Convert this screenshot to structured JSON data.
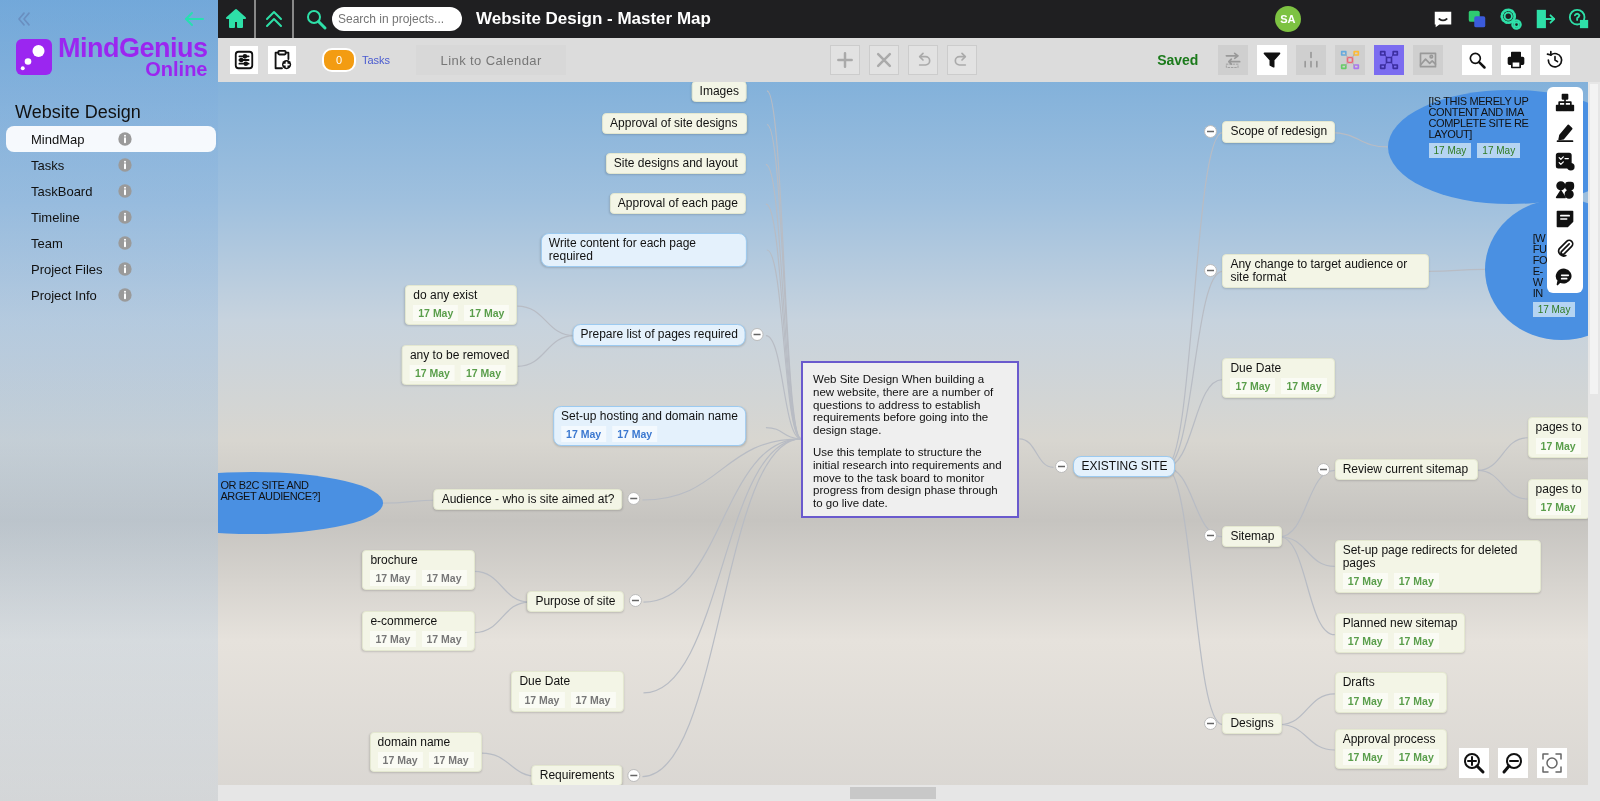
{
  "sidebar": {
    "logo": {
      "name": "MindGenius",
      "subtitle": "Online"
    },
    "project_title": "Website Design",
    "items": [
      {
        "label": "MindMap",
        "selected": true
      },
      {
        "label": "Tasks",
        "selected": false
      },
      {
        "label": "TaskBoard",
        "selected": false
      },
      {
        "label": "Timeline",
        "selected": false
      },
      {
        "label": "Team",
        "selected": false
      },
      {
        "label": "Project Files",
        "selected": false
      },
      {
        "label": "Project Info",
        "selected": false
      }
    ]
  },
  "topbar": {
    "search": {
      "placeholder": "Search in projects..."
    },
    "title": "Website Design - Master Map",
    "avatar": "SA"
  },
  "toolbar": {
    "tasks_count": "0",
    "tasks_label": "Tasks",
    "calendar_button": "Link to Calendar",
    "save_status": "Saved",
    "edit_buttons": [
      {
        "kind": "add",
        "disabled": true
      },
      {
        "kind": "delete",
        "disabled": true
      },
      {
        "kind": "undo",
        "disabled": true
      },
      {
        "kind": "redo",
        "disabled": true
      }
    ],
    "view_buttons": [
      {
        "kind": "wrap",
        "disabled": true,
        "selected": false
      },
      {
        "kind": "filter",
        "disabled": false,
        "selected": false
      },
      {
        "kind": "numbering",
        "disabled": true,
        "selected": false
      },
      {
        "kind": "colour-map",
        "disabled": true,
        "selected": false
      },
      {
        "kind": "map-layout",
        "disabled": false,
        "selected": true
      },
      {
        "kind": "image",
        "disabled": true,
        "selected": false
      },
      {
        "kind": "search",
        "disabled": false,
        "selected": false
      },
      {
        "kind": "print",
        "disabled": false,
        "selected": false
      },
      {
        "kind": "history",
        "disabled": false,
        "selected": false
      }
    ]
  },
  "map": {
    "note": {
      "paragraphs": [
        "Web Site Design When building a new website, there are a number of questions to address to establish requirements before going into the design stage.",
        "Use this template to structure the initial research into requirements and move to the task board to monitor progress from design phase through to go live date."
      ]
    },
    "nodes": [
      {
        "kind": "topic",
        "text": "Images"
      },
      {
        "kind": "topic",
        "text": "Approval of site designs"
      },
      {
        "kind": "topic",
        "text": "Site designs and layout"
      },
      {
        "kind": "topic",
        "text": "Approval of each page"
      },
      {
        "kind": "task",
        "text": "Write content for each page required"
      },
      {
        "kind": "topic",
        "text": "do any exist",
        "dates": [
          "17 May",
          "17 May"
        ],
        "color": "#5a9e4b"
      },
      {
        "kind": "topic",
        "text": "any to be removed",
        "dates": [
          "17 May",
          "17 May"
        ],
        "color": "#5a9e4b"
      },
      {
        "kind": "task",
        "text": "Prepare list of pages required",
        "expanded": true
      },
      {
        "kind": "task",
        "text": "Set-up hosting and domain name",
        "dates": [
          "17 May",
          "17 May"
        ],
        "color": "#3b78d0"
      },
      {
        "kind": "topic",
        "text": "Audience - who is site aimed at?",
        "expanded": true
      },
      {
        "kind": "topic",
        "text": "brochure",
        "dates": [
          "17 May",
          "17 May"
        ],
        "color": "#777777"
      },
      {
        "kind": "topic",
        "text": "e-commerce",
        "dates": [
          "17 May",
          "17 May"
        ],
        "color": "#777777"
      },
      {
        "kind": "topic",
        "text": "Purpose of site",
        "expanded": true
      },
      {
        "kind": "topic",
        "text": "Due Date",
        "dates": [
          "17 May",
          "17 May"
        ],
        "color": "#777777"
      },
      {
        "kind": "topic",
        "text": "domain name",
        "dates": [
          "17 May",
          "17 May"
        ],
        "color": "#777777"
      },
      {
        "kind": "topic",
        "text": "Requirements",
        "expanded": true
      },
      {
        "kind": "topic",
        "text": "Scope of redesign",
        "expanded": true
      },
      {
        "kind": "topic",
        "text": "Any change to target audience or site format",
        "expanded": true
      },
      {
        "kind": "topic",
        "text": "Due Date",
        "dates": [
          "17 May",
          "17 May"
        ],
        "color": "#5a9e4b"
      },
      {
        "kind": "task",
        "text": "EXISTING SITE",
        "expanded": true
      },
      {
        "kind": "topic",
        "text": "Review current sitemap",
        "expanded": true
      },
      {
        "kind": "topic",
        "text": "pages to",
        "dates": [
          "17 May"
        ],
        "color": "#5a9e4b"
      },
      {
        "kind": "topic",
        "text": "pages to",
        "dates": [
          "17 May"
        ],
        "color": "#5a9e4b"
      },
      {
        "kind": "topic",
        "text": "Sitemap",
        "expanded": true
      },
      {
        "kind": "topic",
        "text": "Set-up page redirects for deleted pages",
        "dates": [
          "17 May",
          "17 May"
        ],
        "color": "#5a9e4b"
      },
      {
        "kind": "topic",
        "text": "Planned new sitemap",
        "dates": [
          "17 May",
          "17 May"
        ],
        "color": "#5a9e4b"
      },
      {
        "kind": "topic",
        "text": "Drafts",
        "dates": [
          "17 May",
          "17 May"
        ],
        "color": "#5a9e4b"
      },
      {
        "kind": "topic",
        "text": "Designs",
        "expanded": true
      },
      {
        "kind": "topic",
        "text": "Approval process",
        "dates": [
          "17 May",
          "17 May"
        ],
        "color": "#5a9e4b"
      }
    ],
    "bubbles": [
      {
        "lines": [
          "OR B2C SITE AND",
          "ARGET AUDIENCE?]"
        ]
      },
      {
        "lines": [
          "[IS THIS MERELY UP",
          "CONTENT AND IMA",
          "COMPLETE SITE RE",
          "LAYOUT]"
        ],
        "dates": [
          "17 May",
          "17 May"
        ]
      },
      {
        "lines": [
          "[W",
          "FU",
          "FO",
          "E-",
          "W",
          "IN"
        ],
        "dates": [
          "17 May"
        ]
      }
    ]
  }
}
